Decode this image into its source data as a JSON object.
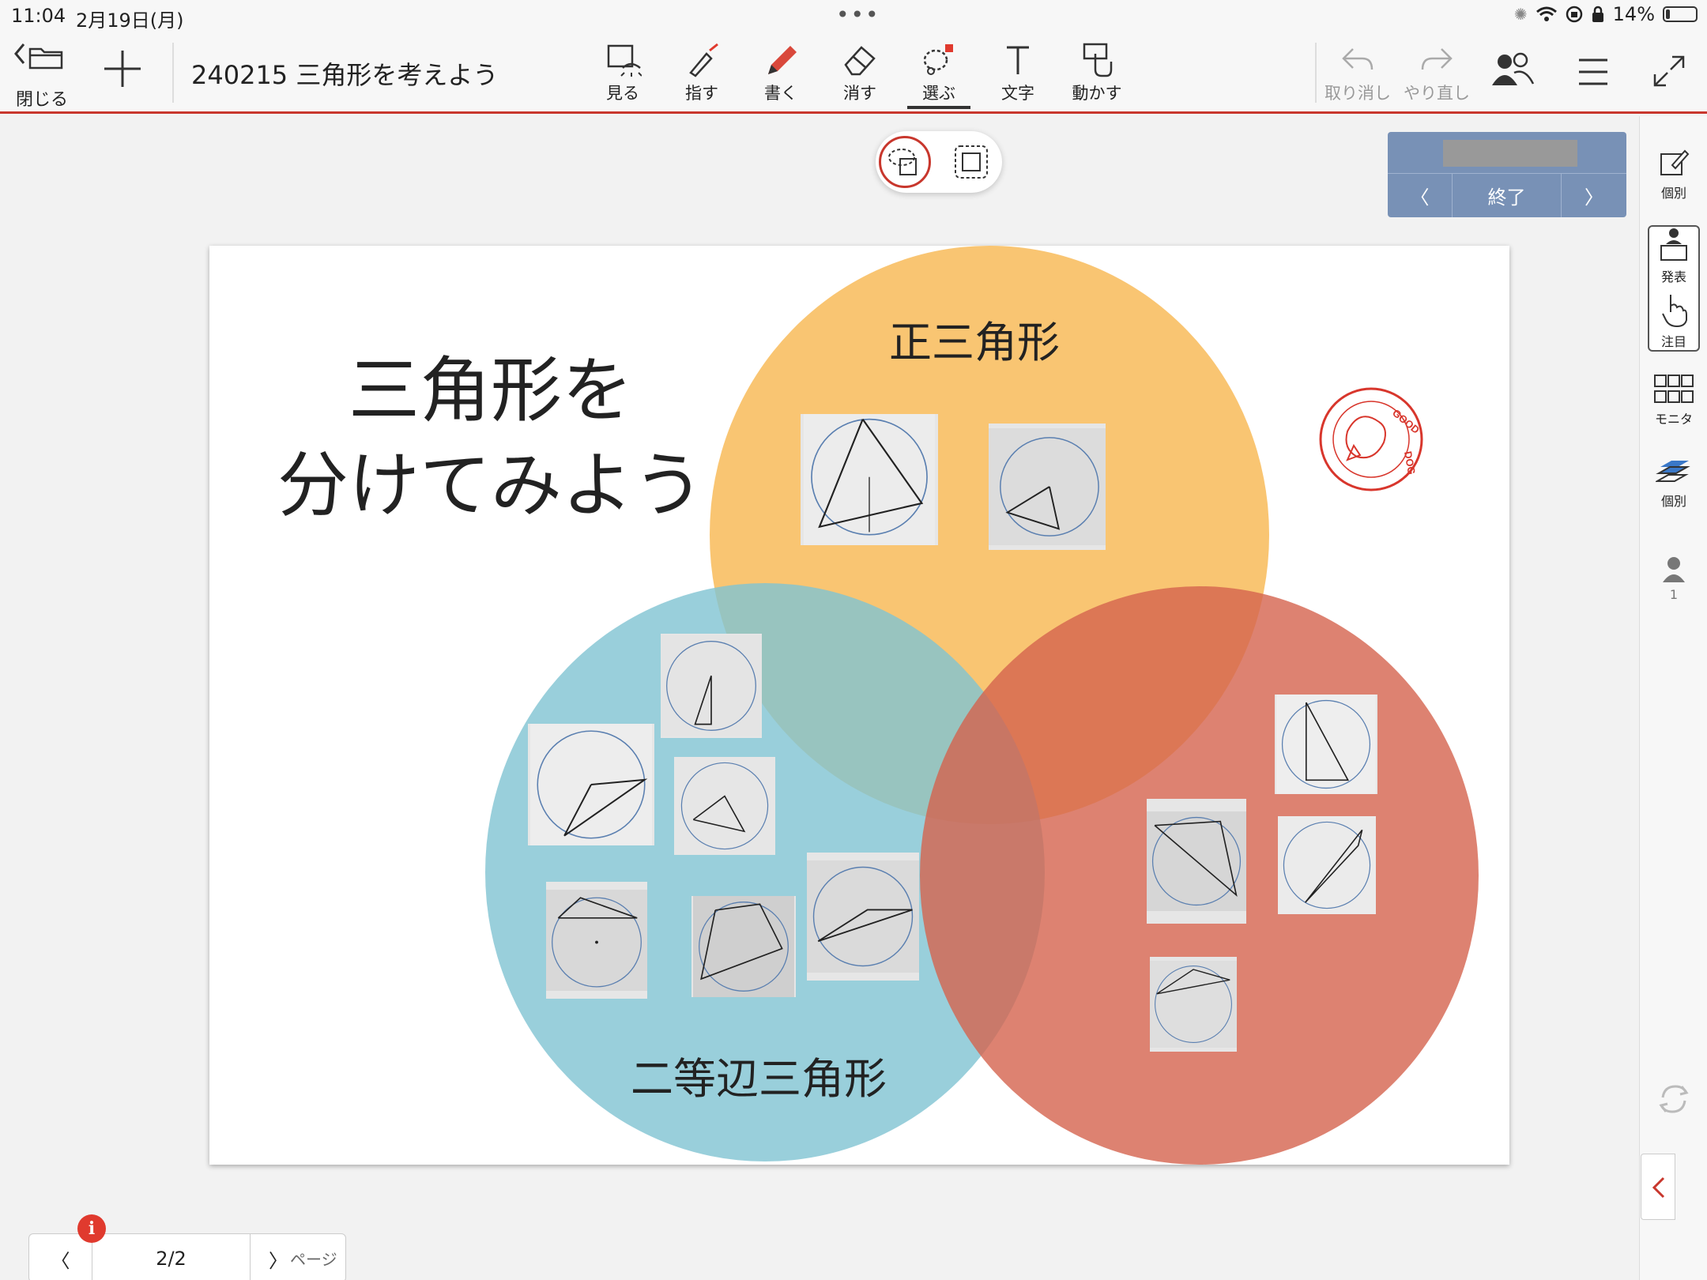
{
  "status_bar": {
    "time": "11:04",
    "date": "2月19日(月)",
    "battery": "14%",
    "battery_level": 0.14
  },
  "toolbar": {
    "close_label": "閉じる",
    "document_title": "240215 三角形を考えよう",
    "tools": [
      {
        "id": "view",
        "label": "見る",
        "icon": "view-icon"
      },
      {
        "id": "point",
        "label": "指す",
        "icon": "pointer-pen-icon"
      },
      {
        "id": "write",
        "label": "書く",
        "icon": "pencil-icon"
      },
      {
        "id": "erase",
        "label": "消す",
        "icon": "eraser-icon"
      },
      {
        "id": "select",
        "label": "選ぶ",
        "icon": "lasso-icon",
        "active": true
      },
      {
        "id": "text",
        "label": "文字",
        "icon": "text-icon"
      },
      {
        "id": "move",
        "label": "動かす",
        "icon": "move-hand-icon"
      }
    ],
    "undo_label": "取り消し",
    "redo_label": "やり直し"
  },
  "presenter": {
    "end_label": "終了"
  },
  "canvas": {
    "title_line1": "三角形を",
    "title_line2": "分けてみよう",
    "set_labels": {
      "equilateral": "正三角形",
      "isosceles": "二等辺三角形"
    },
    "colors": {
      "orange": "#f7b143",
      "blue": "#7fc3d2",
      "red": "#d4634e"
    },
    "stamp_text": "GOOD DOG"
  },
  "sidebar": {
    "individual_label": "個別",
    "present_label": "発表",
    "attention_label": "注目",
    "monitor_label": "モニタ",
    "individual2_label": "個別",
    "user_count": "1"
  },
  "page_nav": {
    "page": "2/2",
    "label": "ページ",
    "badge": "i"
  }
}
